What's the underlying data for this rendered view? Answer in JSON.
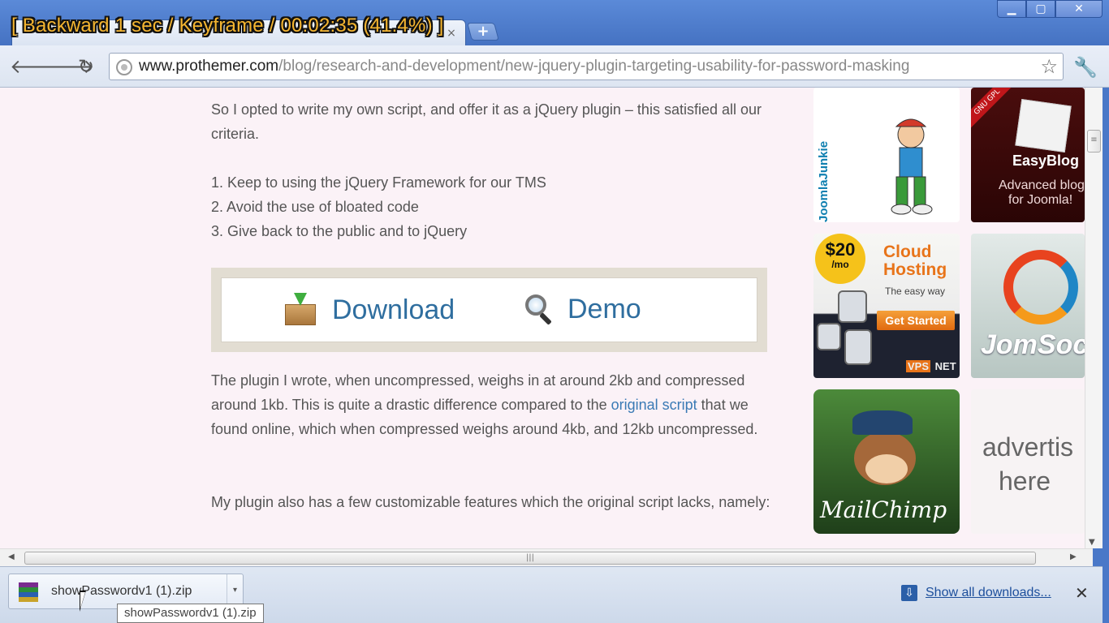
{
  "overlay": {
    "text": "[ Backward 1 sec / Keyframe / 00:02:35 (41.4%) ]"
  },
  "window": {
    "minimize_icon": "minimize-icon",
    "maximize_icon": "maximize-icon",
    "close_icon": "close-icon"
  },
  "tabs": {
    "new_tab_label": "+"
  },
  "toolbar": {
    "url_host": "www.prothemer.com",
    "url_path": "/blog/research-and-development/new-jquery-plugin-targeting-usability-for-password-masking"
  },
  "article": {
    "intro": "So I opted to write my own script, and offer it as a jQuery plugin – this satisfied all our criteria.",
    "criteria": [
      "1. Keep to using the jQuery Framework for our TMS",
      "2. Avoid the use of bloated code",
      "3. Give back to the public and to jQuery"
    ],
    "download_label": "Download",
    "demo_label": "Demo",
    "para2_before": "The plugin I wrote, when uncompressed, weighs in at around 2kb and compressed around 1kb. This is quite a drastic difference compared to the ",
    "para2_link": "original script",
    "para2_after": " that we found online, which when compressed weighs around 4kb, and 12kb uncompressed.",
    "para3": "My plugin also has a few customizable features which the original script lacks, namely:"
  },
  "ads": {
    "joomlajunkie": "JoomlaJunkie",
    "easyblog_ribbon": "GNU GPL",
    "easyblog_title": "EasyBlog",
    "easyblog_sub1": "Advanced blog",
    "easyblog_sub2": "for Joomla!",
    "cloud_price": "$20",
    "cloud_price_unit": "/mo",
    "cloud_title1": "Cloud",
    "cloud_title2": "Hosting",
    "cloud_tagline": "The easy way",
    "cloud_button": "Get Started",
    "cloud_vps": "VPS",
    "cloud_net": "NET",
    "jomsocial": "JomSocia",
    "mailchimp": "MailChimp",
    "advert_line1": "advertis",
    "advert_line2": "here"
  },
  "downloads": {
    "file_name": "showPasswordv1 (1).zip",
    "tooltip": "showPasswordv1 (1).zip",
    "show_all": "Show all downloads..."
  }
}
